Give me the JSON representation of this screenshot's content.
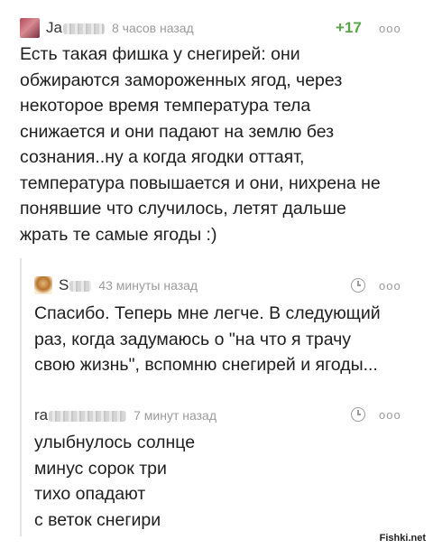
{
  "comments": [
    {
      "user_visible": "Ja",
      "time": "8 часов назад",
      "rating": "+17",
      "more": "ooo",
      "lines": [
        "Есть такая фишка у снегирей: они",
        "обжираются замороженных ягод, через",
        "некоторое время температура тела",
        "снижается и они падают на землю без",
        "сознания..ну а когда ягодки оттаят,",
        "температура повышается и они, нихрена не",
        "понявшие что случилось, летят дальше",
        "жрать те самые ягоды :)"
      ]
    },
    {
      "user_visible": "S",
      "time": "43 минуты назад",
      "more": "ooo",
      "lines": [
        "Спасибо. Теперь мне легче. В следующий",
        "раз, когда задумаюсь о \"на что я трачу",
        "свою жизнь\", вспомню снегирей и ягоды..."
      ]
    },
    {
      "user_visible": "ra",
      "time": "7 минут назад",
      "more": "ooo",
      "lines": [
        "улыбнулось солнце",
        "минус сорок три",
        "тихо опадают",
        "с веток снегири"
      ]
    }
  ],
  "watermark": "Fishki.net",
  "colors": {
    "rating": "#58a449",
    "meta": "#9a9a9a",
    "text": "#1e1e1e"
  }
}
